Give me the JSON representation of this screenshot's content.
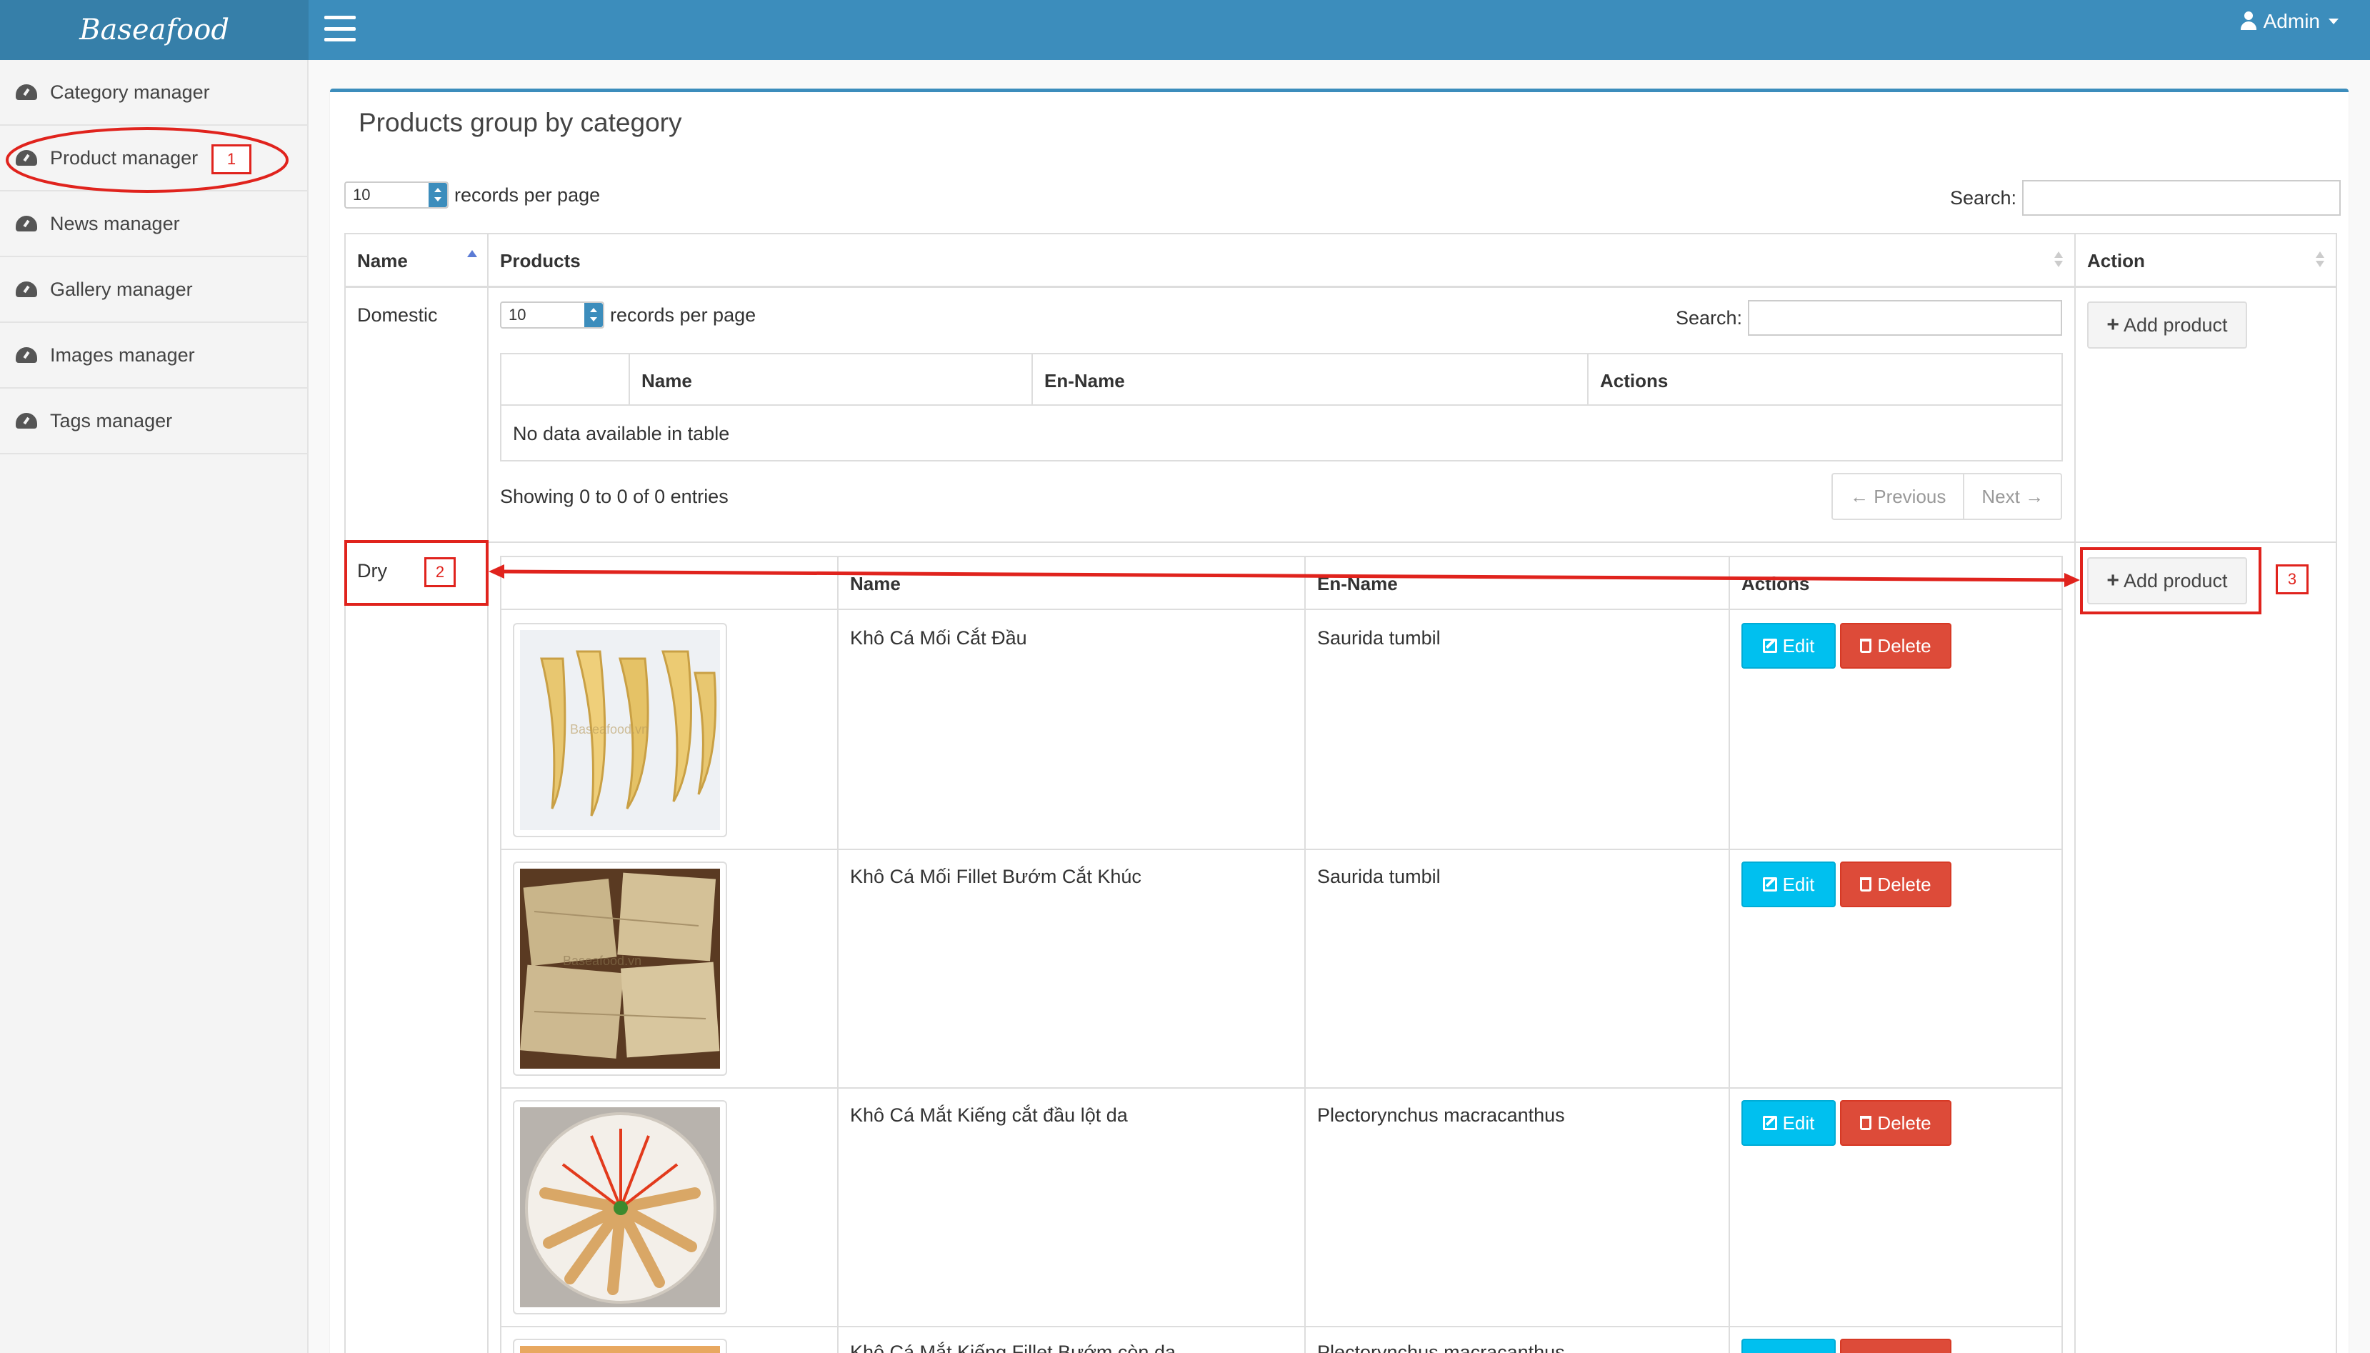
{
  "app": {
    "logo": "Baseafood",
    "user_label": "Admin"
  },
  "sidebar": {
    "items": [
      {
        "label": "Category manager"
      },
      {
        "label": "Product manager"
      },
      {
        "label": "News manager"
      },
      {
        "label": "Gallery manager"
      },
      {
        "label": "Images manager"
      },
      {
        "label": "Tags manager"
      }
    ]
  },
  "page": {
    "title": "Products group by category",
    "length_value": "10",
    "length_suffix": "records per page",
    "search_label": "Search:",
    "search_value": ""
  },
  "outer_table": {
    "headers": {
      "name": "Name",
      "products": "Products",
      "action": "Action"
    },
    "add_product_label": "Add product"
  },
  "categories": [
    {
      "name": "Domestic",
      "inner": {
        "length_value": "10",
        "length_suffix": "records per page",
        "search_label": "Search:",
        "headers": {
          "name": "Name",
          "en_name": "En-Name",
          "actions": "Actions"
        },
        "empty_message": "No data available in table",
        "info": "Showing 0 to 0 of 0 entries",
        "prev_label": "← Previous",
        "next_label": "Next →"
      }
    },
    {
      "name": "Dry",
      "inner": {
        "headers": {
          "name": "Name",
          "en_name": "En-Name",
          "actions": "Actions"
        },
        "rows": [
          {
            "name": "Khô Cá Mối Cắt Đầu",
            "en_name": "Saurida tumbil",
            "image_watermark": "Baseafood.vn"
          },
          {
            "name": "Khô Cá Mối Fillet Bướm Cắt Khúc",
            "en_name": "Saurida tumbil",
            "image_watermark": "Baseafood.vn"
          },
          {
            "name": "Khô Cá Mắt Kiếng cắt đầu lột da",
            "en_name": "Plectorynchus macracanthus",
            "image_watermark": ""
          },
          {
            "name": "Khô Cá Mắt Kiếng Fillet Bướm còn da",
            "en_name": "Plectorynchus macracanthus",
            "image_watermark": ""
          }
        ]
      }
    }
  ],
  "row_actions": {
    "edit_label": "Edit",
    "delete_label": "Delete"
  },
  "annotations": {
    "n1": "1",
    "n2": "2",
    "n3": "3"
  },
  "colors": {
    "header_blue": "#3c8dbc",
    "logo_blue": "#367fa9",
    "edit_cyan": "#00c0ef",
    "delete_red": "#dd4b39",
    "annotation_red": "#e0231d"
  }
}
